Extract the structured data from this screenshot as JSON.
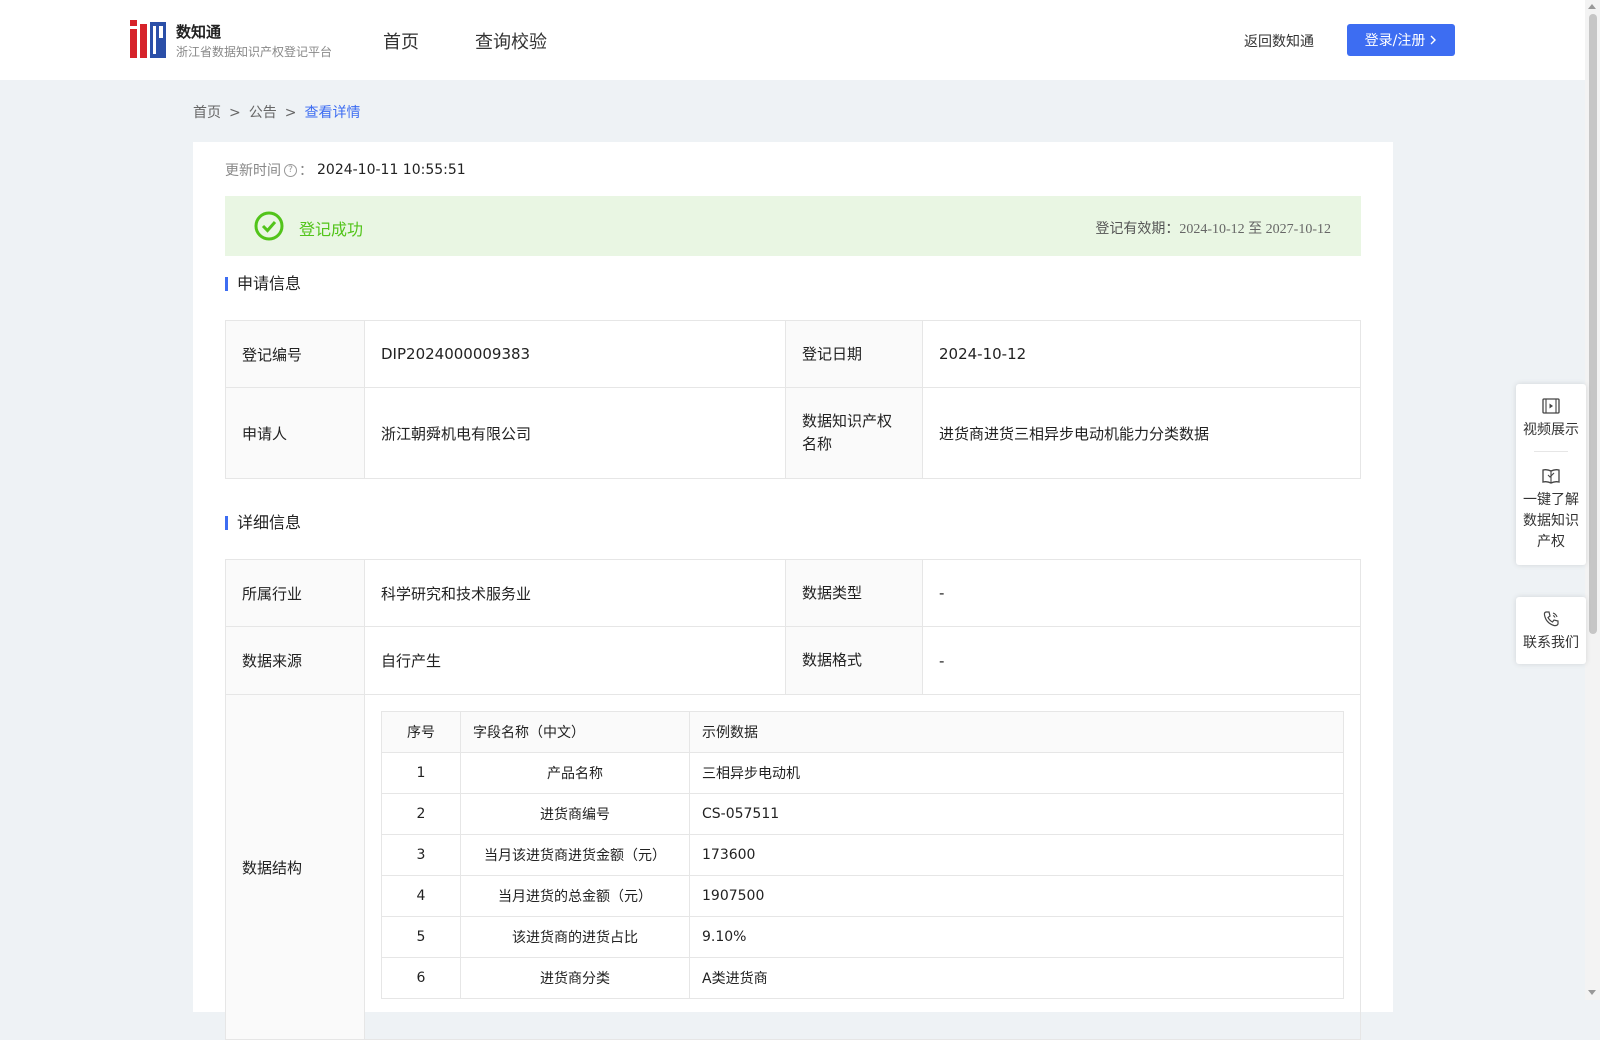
{
  "header": {
    "logo_title": "数知通",
    "logo_subtitle": "浙江省数据知识产权登记平台",
    "nav": [
      "首页",
      "查询校验"
    ],
    "back_link": "返回数知通",
    "login_button": "登录/注册"
  },
  "breadcrumb": {
    "items": [
      "首页",
      "公告"
    ],
    "current": "查看详情",
    "separator": ">"
  },
  "update": {
    "label": "更新时间",
    "colon": "：",
    "value": "2024-10-11 10:55:51"
  },
  "status": {
    "text": "登记成功",
    "validity_label": "登记有效期：",
    "validity_value": "2024-10-12 至 2027-10-12",
    "color": "#52c41a"
  },
  "application": {
    "title": "申请信息",
    "reg_no_label": "登记编号",
    "reg_no": "DIP2024000009383",
    "reg_date_label": "登记日期",
    "reg_date": "2024-10-12",
    "applicant_label": "申请人",
    "applicant": "浙江朝舜机电有限公司",
    "ip_name_label": "数据知识产权名称",
    "ip_name": "进货商进货三相异步电动机能力分类数据"
  },
  "detail": {
    "title": "详细信息",
    "industry_label": "所属行业",
    "industry": "科学研究和技术服务业",
    "data_type_label": "数据类型",
    "data_type": "-",
    "source_label": "数据来源",
    "source": "自行产生",
    "format_label": "数据格式",
    "format": "-",
    "structure_label": "数据结构",
    "structure": {
      "headers": [
        "序号",
        "字段名称（中文）",
        "示例数据"
      ],
      "rows": [
        [
          "1",
          "产品名称",
          "三相异步电动机"
        ],
        [
          "2",
          "进货商编号",
          "CS-057511"
        ],
        [
          "3",
          "当月该进货商进货金额（元）",
          "173600"
        ],
        [
          "4",
          "当月进货的总金额（元）",
          "1907500"
        ],
        [
          "5",
          "该进货商的进货占比",
          "9.10%"
        ],
        [
          "6",
          "进货商分类",
          "A类进货商"
        ]
      ]
    }
  },
  "side_float": {
    "video": "视频展示",
    "learn": "一键了解数据知识产权",
    "contact": "联系我们"
  },
  "colors": {
    "accent": "#3d6df2",
    "success_bg": "#e9f6e3",
    "page_bg": "#eef2f5"
  }
}
